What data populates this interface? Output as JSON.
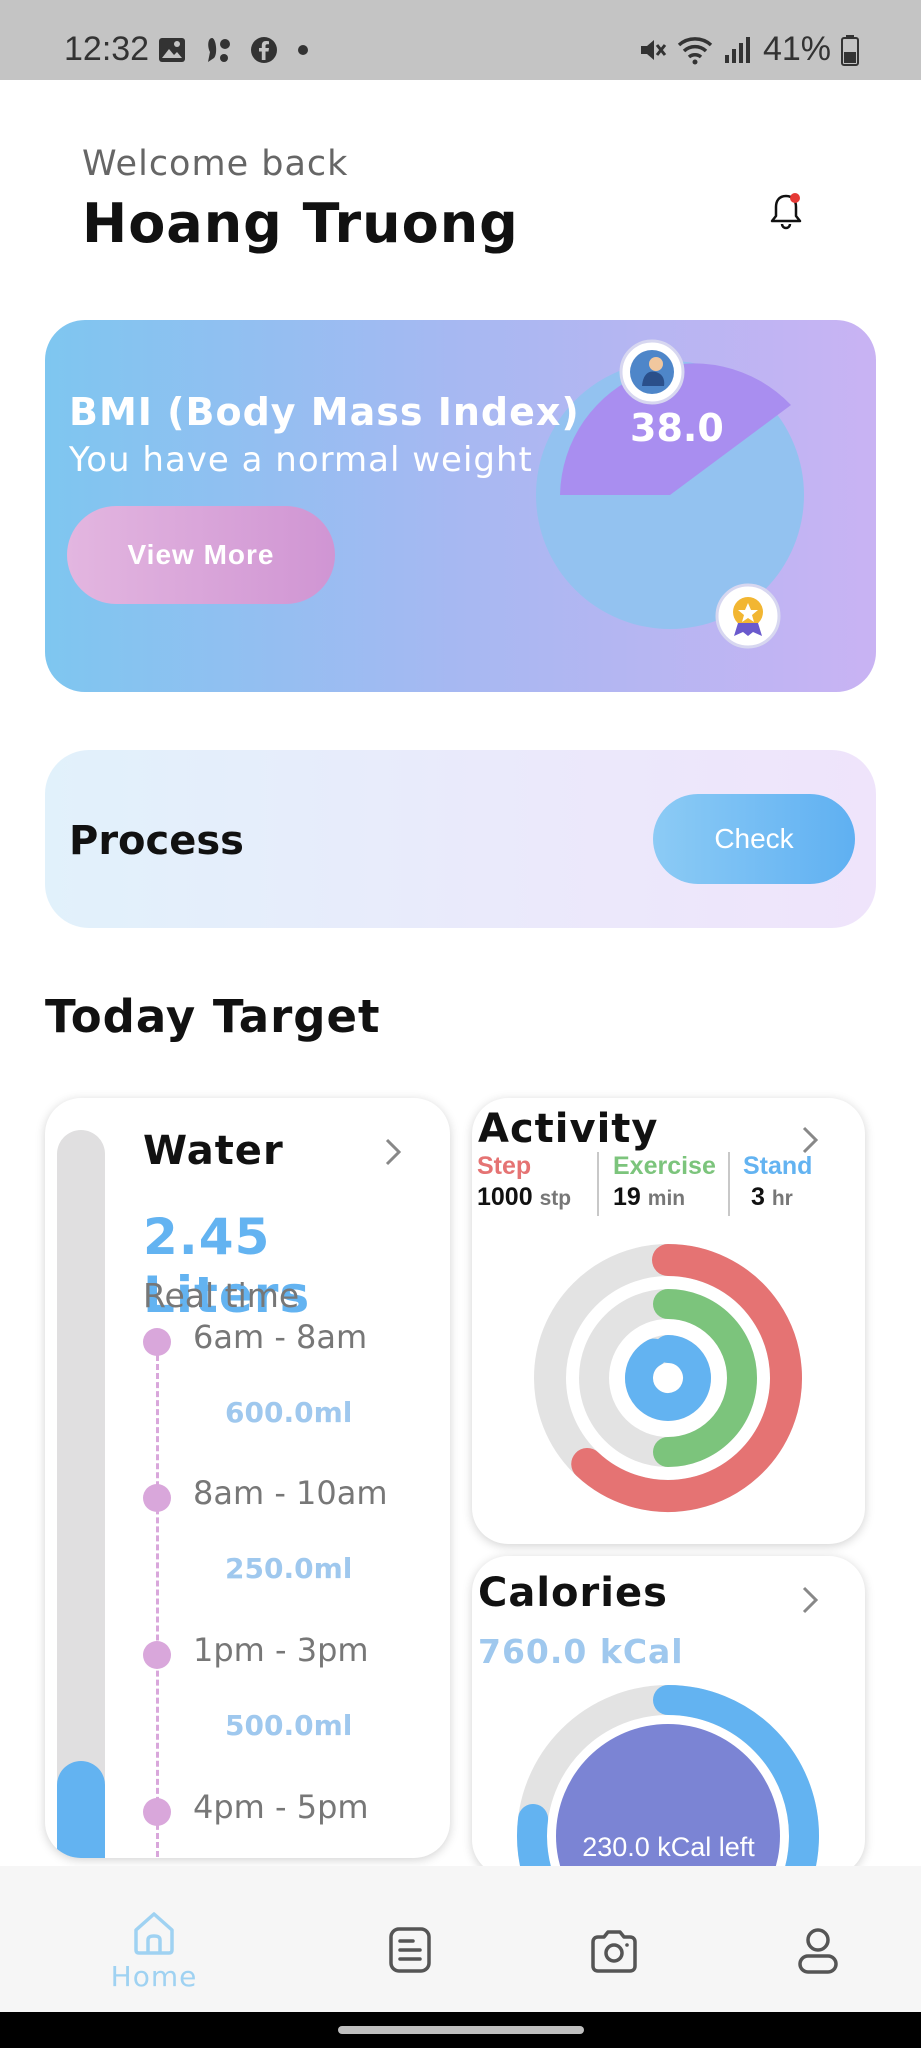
{
  "status_bar": {
    "time": "12:32",
    "battery": "41%",
    "left_icons": [
      "image-icon",
      "voicemail-icon",
      "facebook-icon",
      "dot-icon"
    ],
    "right_icons": [
      "mute-icon",
      "wifi-icon",
      "signal-icon",
      "battery-icon"
    ]
  },
  "header": {
    "welcome": "Welcome back",
    "username": "Hoang Truong",
    "notification_dot_color": "#e53935"
  },
  "bmi": {
    "title": "BMI (Body Mass Index)",
    "subtitle": "You have a normal weight",
    "button_label": "View More",
    "value": "38.0"
  },
  "process": {
    "label": "Process",
    "button_label": "Check"
  },
  "today": {
    "title": "Today Target"
  },
  "water": {
    "title": "Water",
    "amount": "2.45 Liters",
    "realtime_label": "Real time",
    "fill_fraction": 0.17,
    "timeline": [
      {
        "time": "6am - 8am",
        "amount": "600.0ml"
      },
      {
        "time": "8am - 10am",
        "amount": "250.0ml"
      },
      {
        "time": "1pm - 3pm",
        "amount": "500.0ml"
      },
      {
        "time": "4pm - 5pm",
        "amount": ""
      }
    ]
  },
  "activity": {
    "title": "Activity",
    "stats": [
      {
        "label": "Step",
        "value": "1000",
        "unit": "stp",
        "color": "#e57373"
      },
      {
        "label": "Exercise",
        "value": "19",
        "unit": "min",
        "color": "#7cc47c"
      },
      {
        "label": "Stand",
        "value": "3",
        "unit": "hr",
        "color": "#63b3f1"
      }
    ],
    "ring_progress": {
      "step": 0.62,
      "exercise": 0.5,
      "stand": 0.92
    },
    "colors": {
      "step": "#e57373",
      "exercise": "#7cc47c",
      "stand": "#63b3f1",
      "track": "#e3e3e3"
    }
  },
  "calories": {
    "title": "Calories",
    "value": "760.0 kCal",
    "left_text": "230.0 kCal left",
    "burned_fraction": 0.77,
    "colors": {
      "ring": "#63b3f1",
      "track": "#e3e3e3",
      "inner": "#7b84d4"
    }
  },
  "nav": {
    "items": [
      {
        "label": "Home",
        "icon": "home-icon",
        "active": true
      },
      {
        "label": "",
        "icon": "document-icon",
        "active": false
      },
      {
        "label": "",
        "icon": "camera-icon",
        "active": false
      },
      {
        "label": "",
        "icon": "profile-icon",
        "active": false
      }
    ],
    "active_color": "#9fd2f2",
    "inactive_color": "#555555"
  }
}
